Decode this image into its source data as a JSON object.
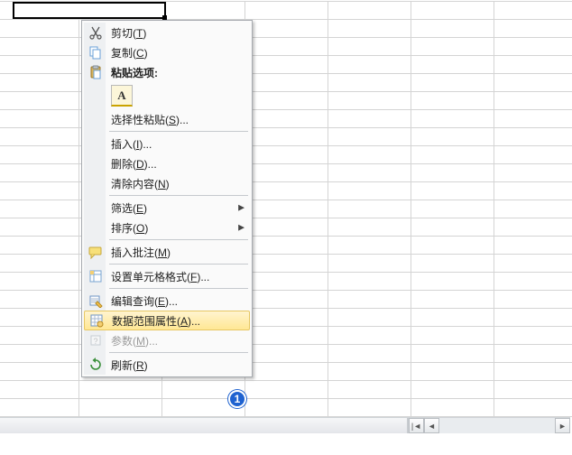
{
  "selected_cell": {
    "value": ""
  },
  "context_menu": {
    "cut": {
      "prefix": "剪切(",
      "hotkey": "T",
      "suffix": ")"
    },
    "copy": {
      "prefix": "复制(",
      "hotkey": "C",
      "suffix": ")"
    },
    "paste_opts": {
      "label": "粘贴选项:"
    },
    "paste_values": {
      "glyph": "A"
    },
    "paste_special": {
      "prefix": "选择性粘贴(",
      "hotkey": "S",
      "suffix": ")..."
    },
    "insert": {
      "prefix": "插入(",
      "hotkey": "I",
      "suffix": ")..."
    },
    "delete": {
      "prefix": "删除(",
      "hotkey": "D",
      "suffix": ")..."
    },
    "clear": {
      "prefix": "清除内容(",
      "hotkey": "N",
      "suffix": ")"
    },
    "filter": {
      "prefix": "筛选(",
      "hotkey": "E",
      "suffix": ")"
    },
    "sort": {
      "prefix": "排序(",
      "hotkey": "O",
      "suffix": ")"
    },
    "insert_comment": {
      "prefix": "插入批注(",
      "hotkey": "M",
      "suffix": ")"
    },
    "format_cells": {
      "prefix": "设置单元格格式(",
      "hotkey": "F",
      "suffix": ")..."
    },
    "edit_query": {
      "prefix": "编辑查询(",
      "hotkey": "E",
      "suffix": ")..."
    },
    "data_range": {
      "prefix": "数据范围属性(",
      "hotkey": "A",
      "suffix": ")..."
    },
    "parameters": {
      "prefix": "参数(",
      "hotkey": "M",
      "suffix": ")..."
    },
    "refresh": {
      "prefix": "刷新(",
      "hotkey": "R",
      "suffix": ")"
    }
  },
  "annotation": {
    "number": "1"
  },
  "scrollbar": {
    "left_arrow": "◄",
    "right_arrow": "►",
    "first": "|◄"
  }
}
